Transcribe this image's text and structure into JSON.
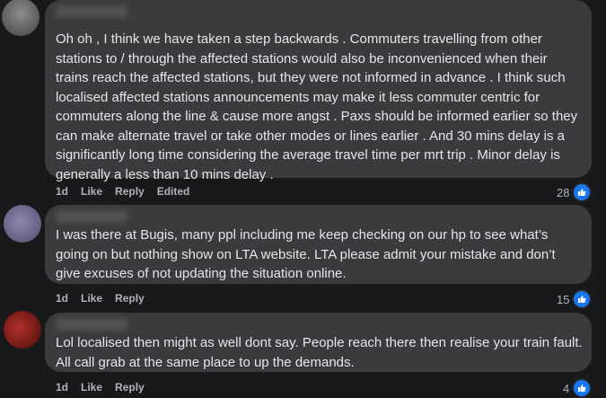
{
  "comments": [
    {
      "author": "",
      "text": "Oh oh , I think we have taken a step backwards . Commuters travelling from other stations to / through the affected stations would also be inconvenienced when their trains reach the affected stations, but they were not informed in advance . I think such localised affected stations announcements may make it less commuter centric for commuters along the line & cause more angst . Paxs should be informed earlier so they can make alternate travel or take other modes or lines earlier . And 30 mins delay is a significantly long time considering the average travel time per mrt trip . Minor delay is generally a less than 10 mins delay .",
      "age": "1d",
      "like_label": "Like",
      "reply_label": "Reply",
      "edited_label": "Edited",
      "reaction_count": "28"
    },
    {
      "author": "",
      "text": "I was there at Bugis, many ppl including me keep checking on our hp to see what’s going on but nothing show on LTA website. LTA please admit your mistake and don’t give excuses of not updating the situation online.",
      "age": "1d",
      "like_label": "Like",
      "reply_label": "Reply",
      "reaction_count": "15"
    },
    {
      "author": "",
      "text": "Lol localised then might as well dont say. People reach there then realise your train fault. All call grab at the same place to up the demands.",
      "age": "1d",
      "like_label": "Like",
      "reply_label": "Reply",
      "reaction_count": "4"
    }
  ],
  "colors": {
    "background": "#18191a",
    "bubble": "#3a3b3c",
    "text": "#e4e6eb",
    "meta": "#b0b3b8",
    "like_blue": "#1877f2"
  },
  "icons": {
    "reaction": "like-thumb-icon"
  }
}
